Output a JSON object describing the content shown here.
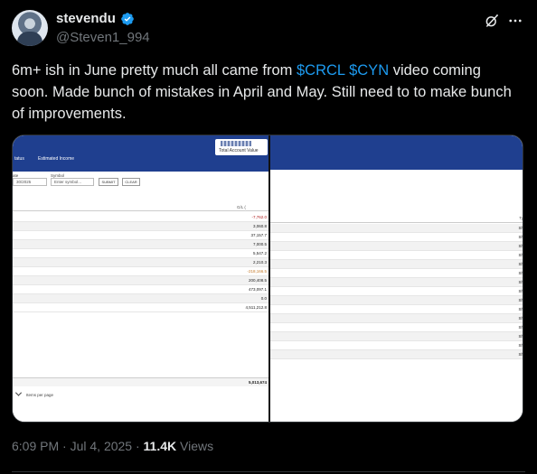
{
  "author": {
    "display_name": "stevendu",
    "handle": "@Steven1_994"
  },
  "tweet": {
    "text_before": "6m+ ish in June pretty much all came from ",
    "cashtag1": "$CRCL",
    "cashtag2": "$CYN",
    "text_after": " video coming soon. Made bunch of mistakes in April and May. Still need to to make bunch of improvements."
  },
  "screenshot": {
    "header": {
      "total_account_value_label": "Total Account Value",
      "tabs": [
        "tatus",
        "Estimated Income"
      ]
    },
    "filters": {
      "date_label": "ate",
      "date_value": "30/2025",
      "symbol_label": "Symbol",
      "symbol_placeholder": "Enter symbol...",
      "submit_label": "SUBMIT",
      "clear_label": "CLEAR"
    },
    "left_column_header": "G/L (",
    "left_values": [
      "-7,762.0",
      "3,060.8",
      "37,157.7",
      "7,000.5",
      "5,547.2",
      "2,210.3",
      "-218,166.5",
      "200,408.5",
      "473,097.1",
      "0.0",
      "4,511,212.8"
    ],
    "total_value": "5,013,674",
    "items_per_page_label": "Items per page",
    "right_column_header": "Ty",
    "right_values": [
      "Sh",
      "Sh",
      "Sh",
      "Sh",
      "Sh",
      "Sh",
      "Sh",
      "Sh",
      "Sh",
      "Sh",
      "Sh",
      "Sh",
      "Sh",
      "Sh",
      "Sh"
    ]
  },
  "meta": {
    "time": "6:09 PM",
    "date": "Jul 4, 2025",
    "separator": "·",
    "views_count": "11.4K",
    "views_label": "Views"
  },
  "colors": {
    "link": "#1d9bf0",
    "verified": "#1d9bf0",
    "banner": "#1f3f8f"
  }
}
